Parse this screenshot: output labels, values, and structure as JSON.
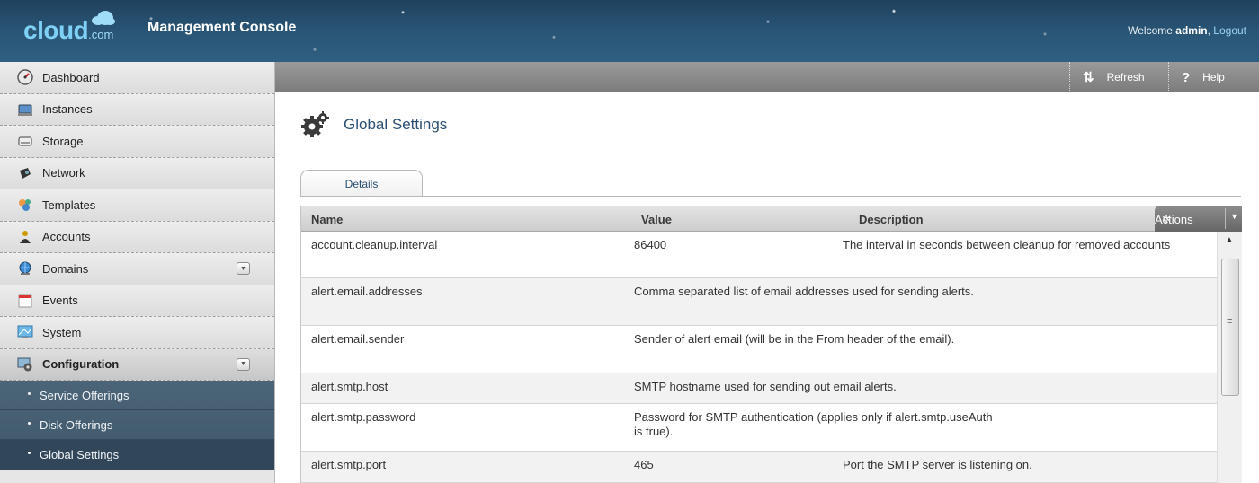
{
  "header": {
    "brand_main": "cloud",
    "brand_com": ".com",
    "console_title": "Management Console",
    "welcome_prefix": "Welcome ",
    "username": "admin",
    "logout_label": "Logout"
  },
  "toolbar": {
    "refresh_label": "Refresh",
    "help_label": "Help"
  },
  "sidebar": {
    "items": [
      {
        "label": "Dashboard",
        "icon": "dashboard-icon"
      },
      {
        "label": "Instances",
        "icon": "instances-icon"
      },
      {
        "label": "Storage",
        "icon": "storage-icon"
      },
      {
        "label": "Network",
        "icon": "network-icon"
      },
      {
        "label": "Templates",
        "icon": "templates-icon"
      },
      {
        "label": "Accounts",
        "icon": "accounts-icon"
      },
      {
        "label": "Domains",
        "icon": "domains-icon",
        "expandable": true
      },
      {
        "label": "Events",
        "icon": "events-icon"
      },
      {
        "label": "System",
        "icon": "system-icon"
      },
      {
        "label": "Configuration",
        "icon": "configuration-icon",
        "expandable": true,
        "expanded": true
      }
    ],
    "sub_items": [
      {
        "label": "Service Offerings"
      },
      {
        "label": "Disk Offerings"
      },
      {
        "label": "Global Settings",
        "active": true
      }
    ]
  },
  "main": {
    "title": "Global Settings",
    "tabs": [
      {
        "label": "Details"
      }
    ],
    "grid": {
      "columns": [
        "Name",
        "Value",
        "Description"
      ],
      "actions_label": "Actions",
      "rows": [
        {
          "name": "account.cleanup.interval",
          "value": "86400",
          "description": "The interval in seconds between cleanup for removed accounts"
        },
        {
          "name": "alert.email.addresses",
          "value": "",
          "description": "Comma separated list of email addresses used for sending alerts."
        },
        {
          "name": "alert.email.sender",
          "value": "",
          "description": "Sender of alert email (will be in the From header of the email)."
        },
        {
          "name": "alert.smtp.host",
          "value": "",
          "description": "SMTP hostname used for sending out email alerts."
        },
        {
          "name": "alert.smtp.password",
          "value": "",
          "description": "Password for SMTP authentication (applies only if alert.smtp.useAuth is true)."
        },
        {
          "name": "alert.smtp.port",
          "value": "465",
          "description": "Port the SMTP server is listening on."
        }
      ]
    }
  },
  "colors": {
    "header_bg": "#2a5677",
    "brand_blue": "#7fd0f5",
    "title_blue": "#2a4f73",
    "subnav_bg": "#4b6478"
  }
}
